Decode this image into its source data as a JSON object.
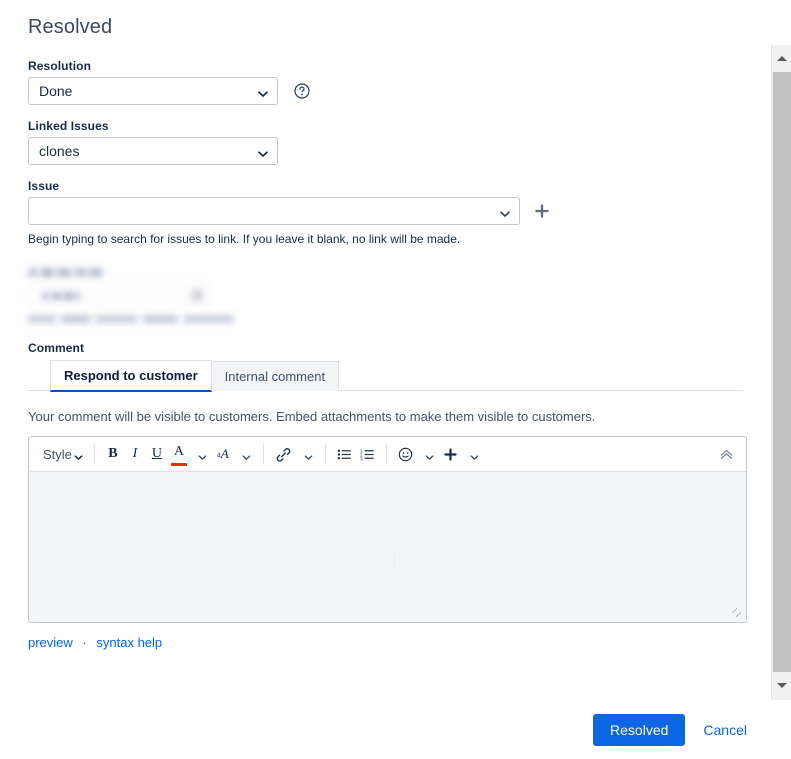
{
  "dialog": {
    "title": "Resolved"
  },
  "fields": {
    "resolution": {
      "label": "Resolution",
      "value": "Done",
      "help_icon": "help-circle-icon"
    },
    "linked_issues": {
      "label": "Linked Issues",
      "value": "clones"
    },
    "issue": {
      "label": "Issue",
      "value": "",
      "add_icon": "plus-icon",
      "hint": "Begin typing to search for issues to link. If you leave it blank, no link will be made."
    }
  },
  "redacted": {
    "note": "blurred-field-block",
    "label_text": "",
    "input_text": "",
    "hint_text": ""
  },
  "comment": {
    "label": "Comment",
    "tabs": [
      {
        "label": "Respond to customer",
        "active": true
      },
      {
        "label": "Internal comment",
        "active": false
      }
    ],
    "visibility_note": "Your comment will be visible to customers. Embed attachments to make them visible to customers.",
    "body_value": "",
    "toolbar": {
      "style_label": "Style",
      "bold": "B",
      "italic": "I",
      "underline": "U",
      "text_color": "A",
      "text_background": "A",
      "link_icon": "link-icon",
      "bullet_list_icon": "bullet-list-icon",
      "numbered_list_icon": "numbered-list-icon",
      "emoji_icon": "emoji-icon",
      "insert_icon": "plus-icon",
      "collapse_icon": "double-chevron-up-icon"
    },
    "links": {
      "preview": "preview",
      "separator": "·",
      "syntax_help": "syntax help"
    }
  },
  "footer": {
    "submit_label": "Resolved",
    "cancel_label": "Cancel"
  },
  "colors": {
    "primary_button": "#0c66e4",
    "link": "#0c66e4",
    "active_tab_underline": "#0052cc",
    "text_color_swatch": "#de350b"
  }
}
